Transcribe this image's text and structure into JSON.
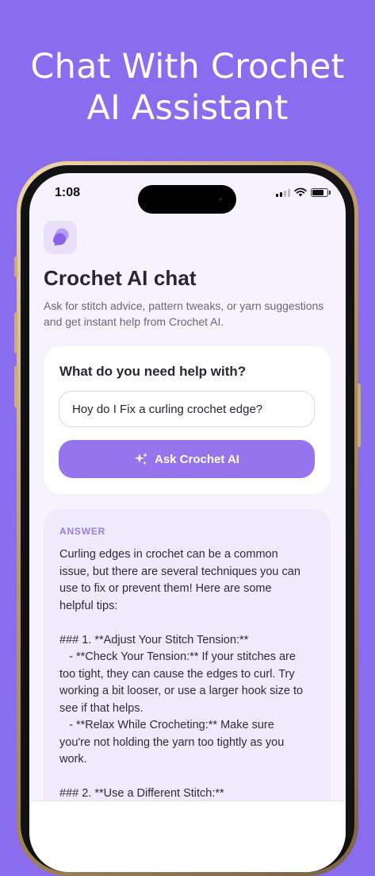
{
  "headline": {
    "line1": "Chat With Crochet",
    "line2": "AI Assistant"
  },
  "status_bar": {
    "time": "1:08"
  },
  "app": {
    "title": "Crochet AI chat",
    "subtitle": "Ask for stitch advice, pattern tweaks, or yarn suggestions and get instant help from Crochet AI."
  },
  "ask": {
    "label": "What do you need help with?",
    "input_value": "Hoy do I Fix a curling crochet edge?",
    "button_label": "Ask Crochet AI"
  },
  "answer": {
    "label": "ANSWER",
    "lines": [
      "Curling edges in crochet can be a common",
      "issue, but there are several techniques you can",
      "use to fix or prevent them! Here are some",
      "helpful tips:",
      "",
      "### 1. **Adjust Your Stitch Tension:**",
      "   - **Check Your Tension:** If your stitches are",
      "too tight, they can cause the edges to curl. Try",
      "working a bit looser, or use a larger hook size to",
      "see if that helps.",
      "   - **Relax While Crocheting:** Make sure",
      "you're not holding the yarn too tightly as you",
      "work.",
      "",
      "### 2. **Use a Different Stitch:**"
    ]
  },
  "colors": {
    "background": "#8a6cee",
    "accent": "#9674ee",
    "answer_label": "#9a7de4",
    "app_icon_bg": "#eadff8",
    "app_icon_fg": "#8b62e6"
  },
  "icons": {
    "app": "chat-bubbles-icon",
    "button": "sparkles-icon",
    "signal": "cellular-signal-icon",
    "wifi": "wifi-icon",
    "battery": "battery-icon"
  }
}
